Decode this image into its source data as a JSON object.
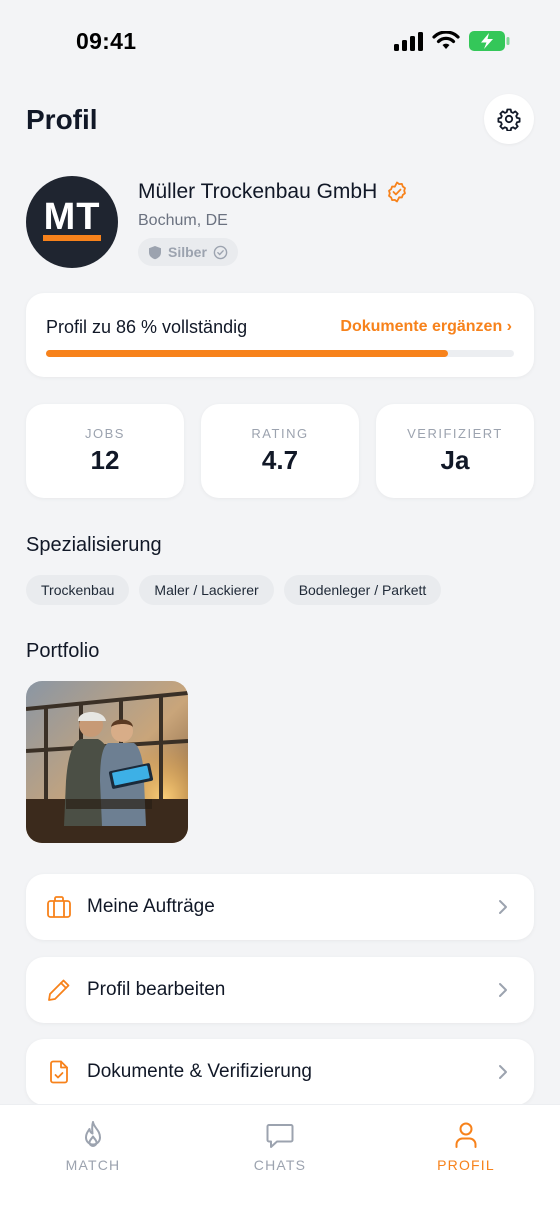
{
  "status_bar": {
    "time": "09:41"
  },
  "header": {
    "title": "Profil"
  },
  "profile": {
    "initials": "MT",
    "company_name": "Müller Trockenbau GmbH",
    "location": "Bochum, DE",
    "tier": "Silber"
  },
  "completion": {
    "text": "Profil zu 86 % vollständig",
    "link": "Dokumente ergänzen ›",
    "percent": 86
  },
  "stats": [
    {
      "label": "JOBS",
      "value": "12"
    },
    {
      "label": "RATING",
      "value": "4.7"
    },
    {
      "label": "VERIFIZIERT",
      "value": "Ja"
    }
  ],
  "specialization": {
    "title": "Spezialisierung",
    "chips": [
      "Trockenbau",
      "Maler / Lackierer",
      "Bodenleger / Parkett"
    ]
  },
  "portfolio": {
    "title": "Portfolio"
  },
  "menu": [
    {
      "label": "Meine Aufträge",
      "icon": "briefcase-icon"
    },
    {
      "label": "Profil bearbeiten",
      "icon": "pencil-icon"
    },
    {
      "label": "Dokumente & Verifizierung",
      "icon": "document-check-icon"
    }
  ],
  "tabs": [
    {
      "label": "MATCH",
      "icon": "flame-icon",
      "active": false
    },
    {
      "label": "CHATS",
      "icon": "chat-bubble-icon",
      "active": false
    },
    {
      "label": "PROFIL",
      "icon": "user-icon",
      "active": true
    }
  ],
  "colors": {
    "accent": "#f7821b",
    "background": "#f3f4f6",
    "avatar_bg": "#1f2530"
  }
}
